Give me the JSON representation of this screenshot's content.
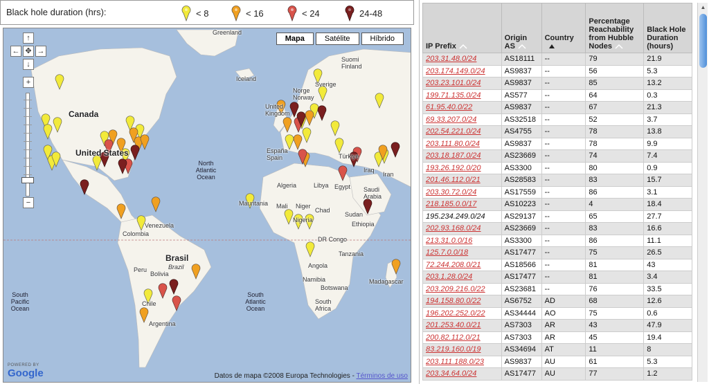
{
  "legend": {
    "title": "Black hole duration (hrs):",
    "items": [
      {
        "label": "< 8",
        "color": "#f2ea3a"
      },
      {
        "label": "< 16",
        "color": "#f0a020"
      },
      {
        "label": "< 24",
        "color": "#d9534a"
      },
      {
        "label": "24-48",
        "color": "#7a1f1f"
      }
    ]
  },
  "map": {
    "types": [
      {
        "label": "Mapa",
        "active": true
      },
      {
        "label": "Satélite",
        "active": false
      },
      {
        "label": "Híbrido",
        "active": false
      }
    ],
    "nav": {
      "up": "↑",
      "down": "↓",
      "left": "←",
      "right": "→",
      "center": "✥",
      "zoom_in": "+",
      "zoom_out": "−"
    },
    "attribution": "Datos de mapa ©2008 Europa Technologies - ",
    "terms_link": "Términos de uso",
    "google_powered": "POWERED BY",
    "google_logo": "Google",
    "labels": {
      "greenland": "Greenland",
      "iceland": "Iceland",
      "canada": "Canada",
      "united_states": "United States",
      "north_atlantic": "North Atlantic Ocean",
      "suomi": "Suomi Finland",
      "norge": "Norge Norway",
      "sverige": "Sverige",
      "united_kingdom": "United Kingdom",
      "espana": "España Spain",
      "turkiye": "Türkiye",
      "iraq": "Iraq",
      "iran": "Iran",
      "algeria": "Algeria",
      "libya": "Libya",
      "egypt": "Egypt",
      "saudi_arabia": "Saudi Arabia",
      "mauritania": "Mauritania",
      "mali": "Mali",
      "niger": "Niger",
      "chad": "Chad",
      "sudan": "Sudan",
      "nigeria": "Nigeria",
      "ethiopia": "Ethiopia",
      "venezuela": "Venezuela",
      "colombia": "Colombia",
      "brasil": "Brasil",
      "brazil": "Brazil",
      "peru": "Peru",
      "bolivia": "Bolivia",
      "dr_congo": "DR Congo",
      "tanzania": "Tanzania",
      "angola": "Angola",
      "namibia": "Namibia",
      "botswana": "Botswana",
      "south_africa": "South Africa",
      "madagascar": "Madagascar",
      "chile": "Chile",
      "argentina": "Argentina",
      "south_pacific": "South Pacific Ocean",
      "south_atlantic": "South Atlantic Ocean"
    }
  },
  "table": {
    "headers": {
      "ip": "IP Prefix",
      "as": "Origin AS",
      "country": "Country",
      "reach": "Percentage Reachability from Hubble Nodes",
      "duration": "Black Hole Duration (hours)"
    },
    "rows": [
      {
        "ip": "203.31.48.0/24",
        "as": "AS18111",
        "country": "--",
        "reach": "79",
        "dur": "21.9",
        "link": true
      },
      {
        "ip": "203.174.149.0/24",
        "as": "AS9837",
        "country": "--",
        "reach": "56",
        "dur": "5.3",
        "link": true
      },
      {
        "ip": "203.23.101.0/24",
        "as": "AS9837",
        "country": "--",
        "reach": "85",
        "dur": "13.2",
        "link": true
      },
      {
        "ip": "199.71.135.0/24",
        "as": "AS577",
        "country": "--",
        "reach": "64",
        "dur": "0.3",
        "link": true
      },
      {
        "ip": "61.95.40.0/22",
        "as": "AS9837",
        "country": "--",
        "reach": "67",
        "dur": "21.3",
        "link": true
      },
      {
        "ip": "69.33.207.0/24",
        "as": "AS32518",
        "country": "--",
        "reach": "52",
        "dur": "3.7",
        "link": true
      },
      {
        "ip": "202.54.221.0/24",
        "as": "AS4755",
        "country": "--",
        "reach": "78",
        "dur": "13.8",
        "link": true
      },
      {
        "ip": "203.111.80.0/24",
        "as": "AS9837",
        "country": "--",
        "reach": "78",
        "dur": "9.9",
        "link": true
      },
      {
        "ip": "203.18.187.0/24",
        "as": "AS23669",
        "country": "--",
        "reach": "74",
        "dur": "7.4",
        "link": true
      },
      {
        "ip": "193.26.192.0/20",
        "as": "AS3300",
        "country": "--",
        "reach": "80",
        "dur": "0.9",
        "link": true
      },
      {
        "ip": "201.46.112.0/21",
        "as": "AS28583",
        "country": "--",
        "reach": "83",
        "dur": "15.7",
        "link": true
      },
      {
        "ip": "203.30.72.0/24",
        "as": "AS17559",
        "country": "--",
        "reach": "86",
        "dur": "3.1",
        "link": true
      },
      {
        "ip": "218.185.0.0/17",
        "as": "AS10223",
        "country": "--",
        "reach": "4",
        "dur": "18.4",
        "link": true
      },
      {
        "ip": "195.234.249.0/24",
        "as": "AS29137",
        "country": "--",
        "reach": "65",
        "dur": "27.7",
        "link": false
      },
      {
        "ip": "202.93.168.0/24",
        "as": "AS23669",
        "country": "--",
        "reach": "83",
        "dur": "16.6",
        "link": true
      },
      {
        "ip": "213.31.0.0/16",
        "as": "AS3300",
        "country": "--",
        "reach": "86",
        "dur": "11.1",
        "link": true
      },
      {
        "ip": "125.7.0.0/18",
        "as": "AS17477",
        "country": "--",
        "reach": "75",
        "dur": "26.5",
        "link": true
      },
      {
        "ip": "72.244.208.0/21",
        "as": "AS18566",
        "country": "--",
        "reach": "81",
        "dur": "43",
        "link": true
      },
      {
        "ip": "203.1.28.0/24",
        "as": "AS17477",
        "country": "--",
        "reach": "81",
        "dur": "3.4",
        "link": true
      },
      {
        "ip": "203.209.216.0/22",
        "as": "AS23681",
        "country": "--",
        "reach": "76",
        "dur": "33.5",
        "link": true
      },
      {
        "ip": "194.158.80.0/22",
        "as": "AS6752",
        "country": "AD",
        "reach": "68",
        "dur": "12.6",
        "link": true
      },
      {
        "ip": "196.202.252.0/22",
        "as": "AS34444",
        "country": "AO",
        "reach": "75",
        "dur": "0.6",
        "link": true
      },
      {
        "ip": "201.253.40.0/21",
        "as": "AS7303",
        "country": "AR",
        "reach": "43",
        "dur": "47.9",
        "link": true
      },
      {
        "ip": "200.82.112.0/21",
        "as": "AS7303",
        "country": "AR",
        "reach": "45",
        "dur": "19.4",
        "link": true
      },
      {
        "ip": "83.219.160.0/19",
        "as": "AS34694",
        "country": "AT",
        "reach": "11",
        "dur": "8",
        "link": true
      },
      {
        "ip": "203.111.188.0/23",
        "as": "AS9837",
        "country": "AU",
        "reach": "61",
        "dur": "5.3",
        "link": true
      },
      {
        "ip": "203.34.64.0/24",
        "as": "AS17477",
        "country": "AU",
        "reach": "77",
        "dur": "1.2",
        "link": true
      }
    ]
  }
}
